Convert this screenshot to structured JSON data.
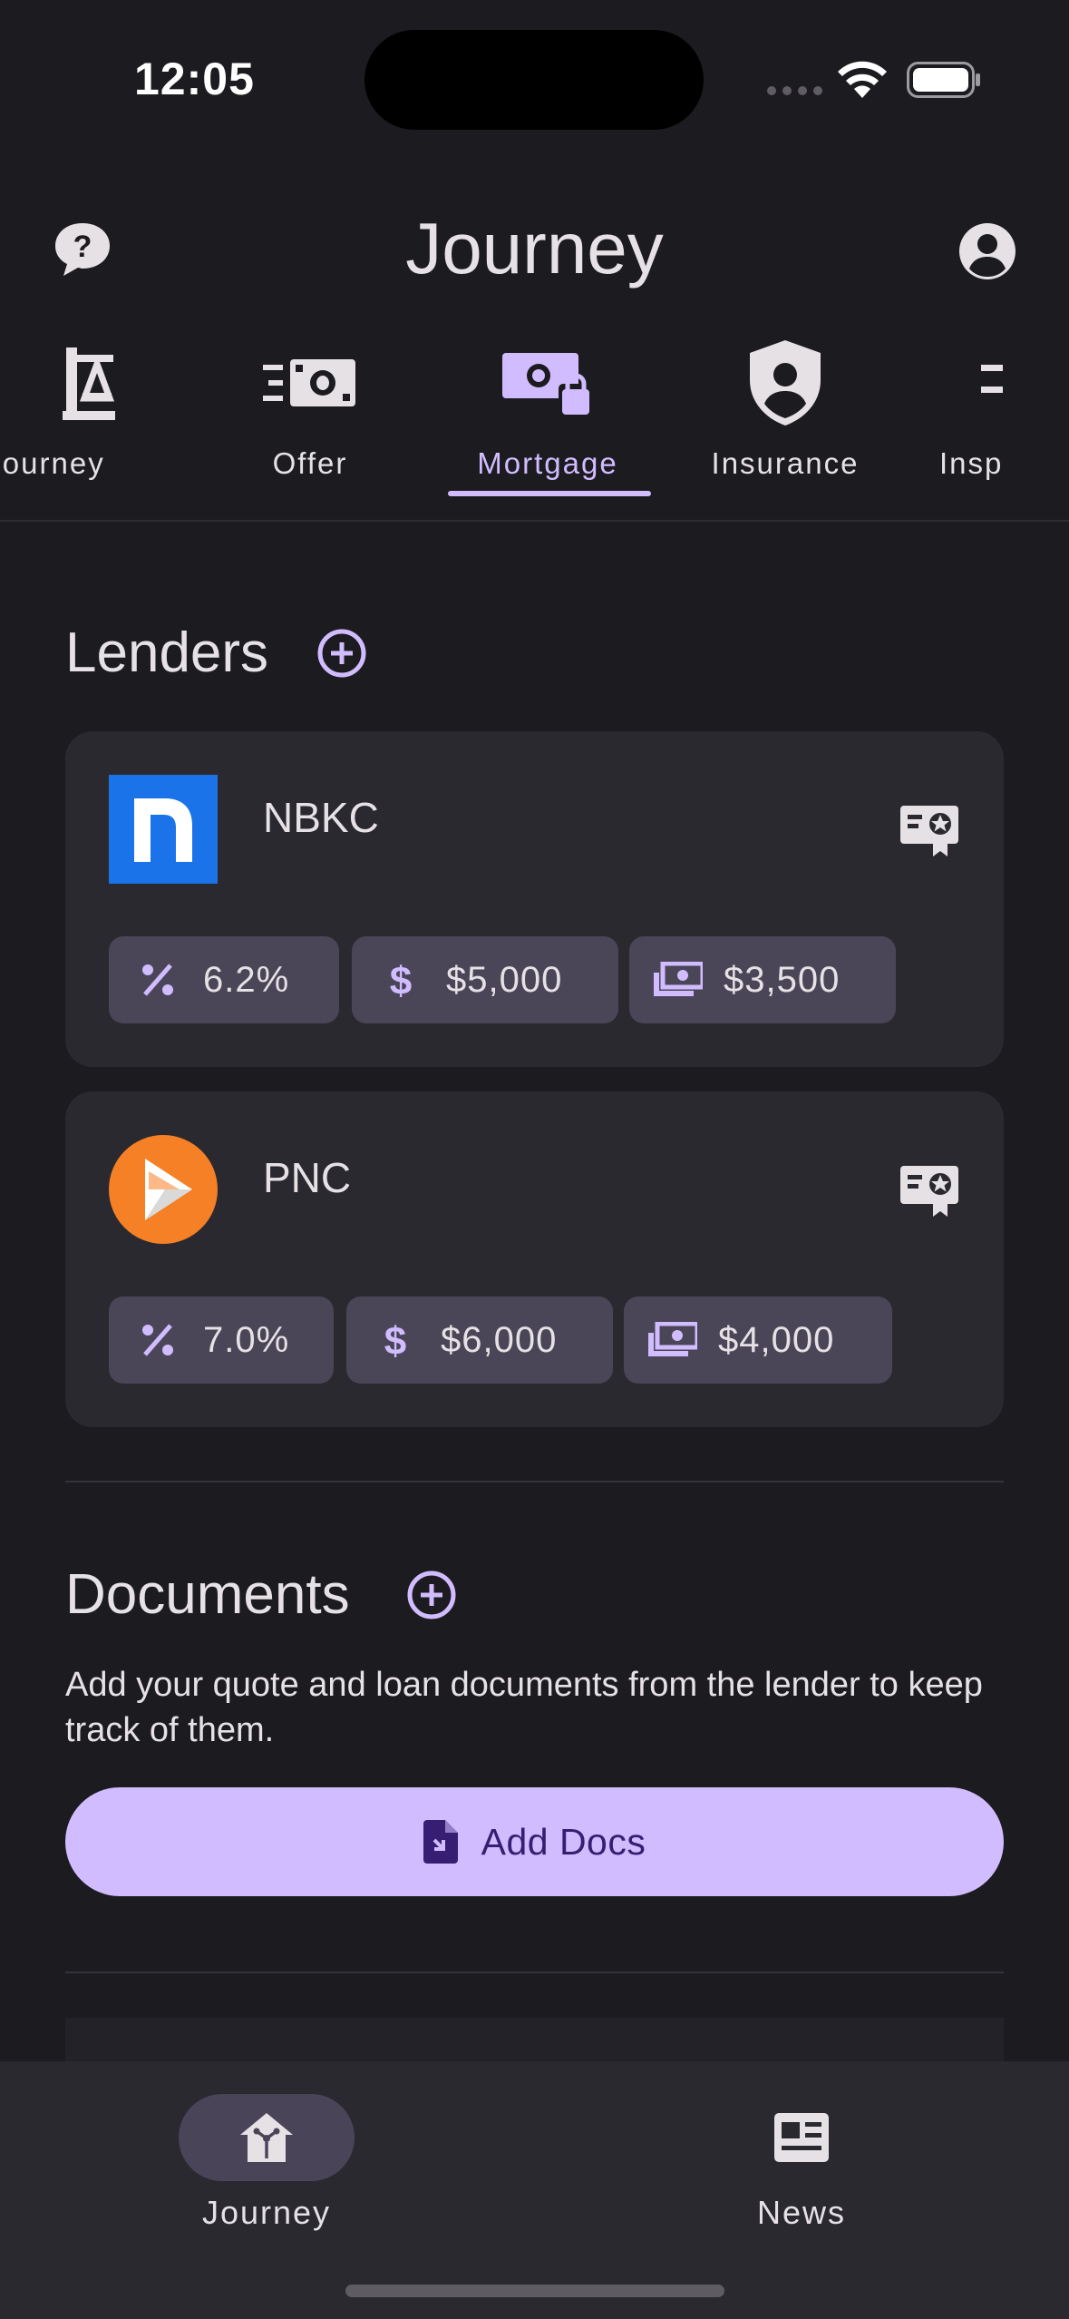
{
  "status_bar": {
    "time": "12:05"
  },
  "app_bar": {
    "title": "Journey",
    "help_icon": "help-bubble-icon",
    "account_icon": "account-circle-icon"
  },
  "tabs": [
    {
      "label": "Journey",
      "icon": "scale-icon",
      "active": false
    },
    {
      "label": "Offer",
      "icon": "fast-money-icon",
      "active": false
    },
    {
      "label": "Mortgage",
      "icon": "money-lock-icon",
      "active": true
    },
    {
      "label": "Insurance",
      "icon": "shield-person-icon",
      "active": false
    },
    {
      "label": "Insp",
      "icon": "inspection-icon",
      "active": false
    }
  ],
  "lenders": {
    "title": "Lenders",
    "items": [
      {
        "name": "NBKC",
        "rate": "6.2%",
        "cost": "$5,000",
        "cash": "$3,500",
        "logo_color": "#1a73e8"
      },
      {
        "name": "PNC",
        "rate": "7.0%",
        "cost": "$6,000",
        "cash": "$4,000",
        "logo_color": "#f58025"
      }
    ]
  },
  "documents": {
    "title": "Documents",
    "description": "Add your quote and loan documents from the lender to keep track of them.",
    "button_label": "Add Docs"
  },
  "bottom_nav": [
    {
      "label": "Journey",
      "icon": "home-network-icon",
      "active": true
    },
    {
      "label": "News",
      "icon": "newspaper-icon",
      "active": false
    }
  ],
  "colors": {
    "accent": "#d0bcff",
    "background": "#1c1b1f",
    "card": "#2a2930",
    "chip": "#4a4657"
  }
}
